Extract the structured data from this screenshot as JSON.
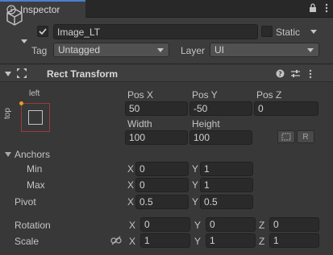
{
  "tab": {
    "title": "Inspector"
  },
  "object": {
    "active": true,
    "name": "Image_LT",
    "static_label": "Static",
    "static_checked": false,
    "tag_label": "Tag",
    "tag_value": "Untagged",
    "layer_label": "Layer",
    "layer_value": "UI"
  },
  "component": {
    "title": "Rect Transform",
    "anchor_preset": {
      "horizontal": "left",
      "vertical": "top"
    },
    "pos_x_label": "Pos X",
    "pos_x": "50",
    "pos_y_label": "Pos Y",
    "pos_y": "-50",
    "pos_z_label": "Pos Z",
    "pos_z": "0",
    "width_label": "Width",
    "width": "100",
    "height_label": "Height",
    "height": "100",
    "raw_button": "R",
    "anchors_label": "Anchors",
    "min_label": "Min",
    "min_x": "0",
    "min_y": "1",
    "max_label": "Max",
    "max_x": "0",
    "max_y": "1",
    "pivot_label": "Pivot",
    "pivot_x": "0.5",
    "pivot_y": "0.5",
    "rotation_label": "Rotation",
    "rot_x": "0",
    "rot_y": "0",
    "rot_z": "0",
    "scale_label": "Scale",
    "scale_x": "1",
    "scale_y": "1",
    "scale_z": "1",
    "axis_x": "X",
    "axis_y": "Y",
    "axis_z": "Z"
  },
  "icons": [
    "info-icon",
    "lock-icon",
    "menu-icon",
    "cube-icon",
    "collapse-icon",
    "rect-transform-icon",
    "help-icon",
    "presets-icon",
    "more-icon",
    "blueprint-icon",
    "constrain-proportions-icon"
  ],
  "colors": {
    "panel": "#383838",
    "header": "#3c3c3c",
    "field": "#2a2a2a",
    "accent": "#4a7fd0",
    "anchor_border": "#9e3a3a",
    "anchor_dot": "#e2a020"
  }
}
